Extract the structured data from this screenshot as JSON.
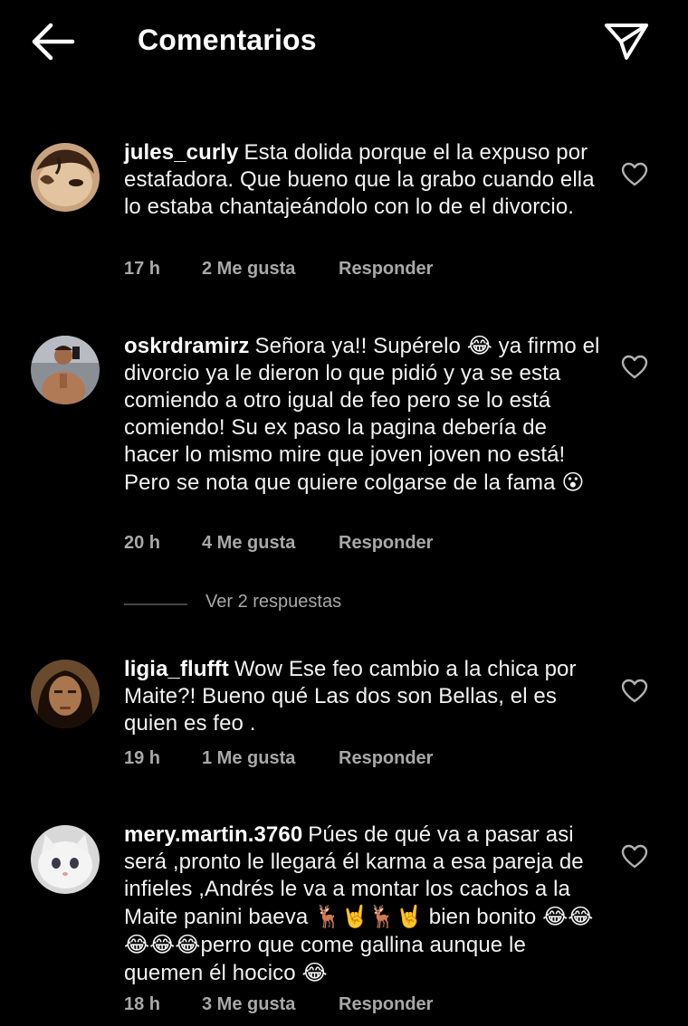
{
  "header": {
    "title": "Comentarios",
    "back_icon": "arrow-left-icon",
    "share_icon": "paper-plane-icon"
  },
  "comments": [
    {
      "username": "jules_curly",
      "text": "Esta dolida porque el la expuso por estafadora.  Que bueno que la grabo cuando ella lo estaba chantajeándolo con lo de el divorcio.",
      "time": "17 h",
      "likes": "2 Me gusta",
      "reply": "Responder"
    },
    {
      "username": "oskrdramirz",
      "text_parts": [
        "Señora ya!! Supérelo ",
        "😂",
        " ya firmo el divorcio ya le dieron lo que pidió y ya se esta comiendo a otro igual de feo pero se lo está comiendo! Su ex paso la pagina debería de hacer lo mismo mire que joven joven no está! Pero se nota que quiere colgarse de la fama ",
        "😮"
      ],
      "time": "20 h",
      "likes": "4 Me gusta",
      "reply": "Responder"
    },
    {
      "username": "ligia_flufft",
      "text": "Wow Ese feo cambio a la chica por Maite?! Bueno qué Las dos son Bellas, el es quien es feo .",
      "time": "19 h",
      "likes": "1 Me gusta",
      "reply": "Responder"
    },
    {
      "username": "mery.martin.3760",
      "text_parts": [
        "Púes de qué va a pasar asi será ,pronto le llegará él karma a esa pareja de infieles ,Andrés le va a montar los cachos a la Maite panini baeva ",
        "🦌🤘🦌🤘",
        " bien bonito ",
        "😂😂😂😂😂",
        "perro que come gallina aunque le quemen él hocico ",
        "😂"
      ],
      "time": "18 h",
      "likes": "3 Me gusta",
      "reply": "Responder"
    }
  ],
  "view_replies": "Ver 2 respuestas",
  "colors": {
    "background": "#000000",
    "text": "#f2f2f2",
    "meta": "#a8a8a8"
  }
}
